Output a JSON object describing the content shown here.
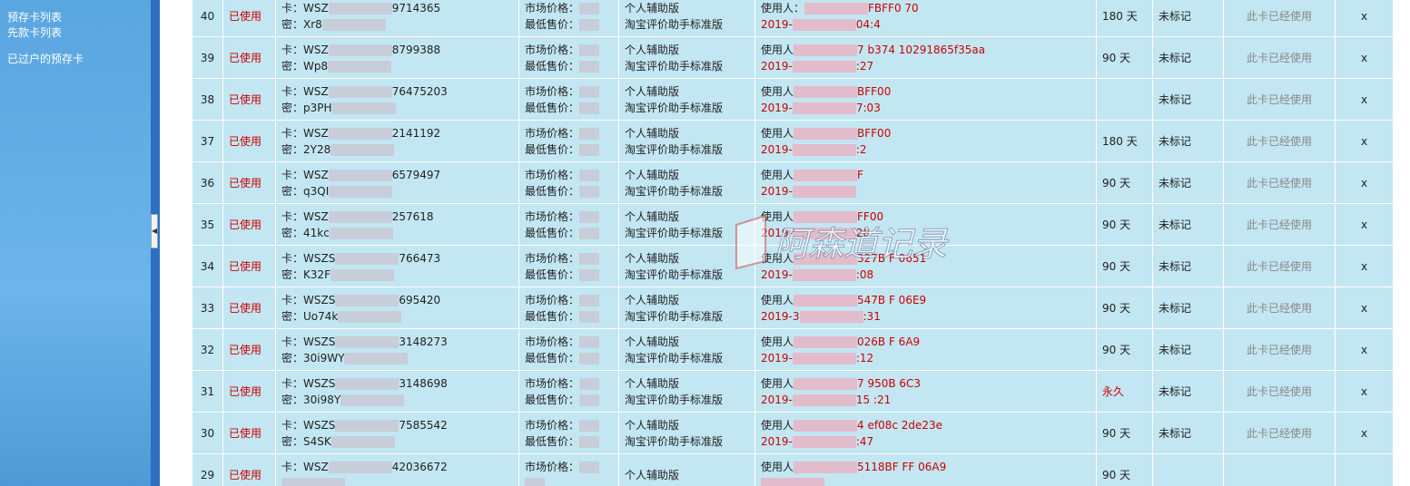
{
  "sidebar": {
    "items": [
      {
        "label": "预存卡列表"
      },
      {
        "label": "先款卡列表"
      },
      {
        "label": "已过户的预存卡"
      }
    ]
  },
  "table": {
    "rows": [
      {
        "id": "40",
        "status": "已使用",
        "card": "卡：WSZ",
        "card_end": "9714365",
        "pwd": "密：Xr8",
        "price_market": "市场价格：",
        "price_min": "最低售价：",
        "product": "个人辅助版",
        "product_full": "淘宝评价助手标准版",
        "user": "使用人：",
        "user_end": "FBFF0   70",
        "date": "2019-",
        "date_end": "04:4",
        "duration": "180 天",
        "mark": "未标记",
        "used": "此卡已经使用",
        "delete": "x"
      },
      {
        "id": "39",
        "status": "已使用",
        "card": "卡：WSZ",
        "card_end": "8799388",
        "pwd": "密：Wp8",
        "price_market": "市场价格：",
        "price_min": "最低售价：",
        "product": "个人辅助版",
        "product_full": "淘宝评价助手标准版",
        "user": "使用人",
        "user_end": "7   b374        10291865f35aa",
        "date": "2019-",
        "date_end": ":27",
        "duration": "90 天",
        "mark": "未标记",
        "used": "此卡已经使用",
        "delete": "x"
      },
      {
        "id": "38",
        "status": "已使用",
        "card": "卡：WSZ",
        "card_end": "76475203",
        "pwd": "密：p3PH",
        "price_market": "市场价格：",
        "price_min": "最低售价：",
        "product": "个人辅助版",
        "product_full": "淘宝评价助手标准版",
        "user": "使用人",
        "user_end": "BFF00",
        "date": "2019-",
        "date_end": "7:03",
        "duration": "",
        "mark": "未标记",
        "used": "此卡已经使用",
        "delete": "x"
      },
      {
        "id": "37",
        "status": "已使用",
        "card": "卡：WSZ",
        "card_end": "2141192",
        "pwd": "密：2Y28",
        "price_market": "市场价格：",
        "price_min": "最低售价：",
        "product": "个人辅助版",
        "product_full": "淘宝评价助手标准版",
        "user": "使用人",
        "user_end": "BFF00",
        "date": "2019-",
        "date_end": ":2",
        "duration": "180 天",
        "mark": "未标记",
        "used": "此卡已经使用",
        "delete": "x"
      },
      {
        "id": "36",
        "status": "已使用",
        "card": "卡：WSZ",
        "card_end": "6579497",
        "pwd": "密：q3QI",
        "price_market": "市场价格：",
        "price_min": "最低售价：",
        "product": "个人辅助版",
        "product_full": "淘宝评价助手标准版",
        "user": "使用人",
        "user_end": "F",
        "date": "2019-",
        "date_end": "",
        "duration": "90 天",
        "mark": "未标记",
        "used": "此卡已经使用",
        "delete": "x"
      },
      {
        "id": "35",
        "status": "已使用",
        "card": "卡：WSZ",
        "card_end": "257618",
        "pwd": "密：41kc",
        "price_market": "市场价格：",
        "price_min": "最低售价：",
        "product": "个人辅助版",
        "product_full": "淘宝评价助手标准版",
        "user": "使用人",
        "user_end": "FF00",
        "date": "2019-",
        "date_end": "28",
        "duration": "90 天",
        "mark": "未标记",
        "used": "此卡已经使用",
        "delete": "x"
      },
      {
        "id": "34",
        "status": "已使用",
        "card": "卡：WSZS",
        "card_end": "766473",
        "pwd": "密：K32F",
        "price_market": "市场价格：",
        "price_min": "最低售价：",
        "product": "个人辅助版",
        "product_full": "淘宝评价助手标准版",
        "user": "使用人",
        "user_end": "327B    F    0651",
        "date": "2019-",
        "date_end": ":08",
        "duration": "90 天",
        "mark": "未标记",
        "used": "此卡已经使用",
        "delete": "x"
      },
      {
        "id": "33",
        "status": "已使用",
        "card": "卡：WSZS",
        "card_end": "695420",
        "pwd": "密：Uo74k",
        "price_market": "市场价格：",
        "price_min": "最低售价：",
        "product": "个人辅助版",
        "product_full": "淘宝评价助手标准版",
        "user": "使用人",
        "user_end": "547B    F    06E9",
        "date": "2019-3",
        "date_end": ":31",
        "duration": "90 天",
        "mark": "未标记",
        "used": "此卡已经使用",
        "delete": "x"
      },
      {
        "id": "32",
        "status": "已使用",
        "card": "卡：WSZS",
        "card_end": "3148273",
        "pwd": "密：30i9WY",
        "price_market": "市场价格：",
        "price_min": "最低售价：",
        "product": "个人辅助版",
        "product_full": "淘宝评价助手标准版",
        "user": "使用人",
        "user_end": "026B    F    6A9",
        "date": "2019-",
        "date_end": ":12",
        "duration": "90 天",
        "mark": "未标记",
        "used": "此卡已经使用",
        "delete": "x"
      },
      {
        "id": "31",
        "status": "已使用",
        "card": "卡：WSZS",
        "card_end": "3148698",
        "pwd": "密：30i98Y",
        "price_market": "市场价格：",
        "price_min": "最低售价：",
        "product": "个人辅助版",
        "product_full": "淘宝评价助手标准版",
        "user": "使用人",
        "user_end": "7   950B        6C3",
        "date": "2019-",
        "date_end": "15   :21",
        "duration": "永久",
        "mark": "未标记",
        "used": "此卡已经使用",
        "delete": "x"
      },
      {
        "id": "30",
        "status": "已使用",
        "card": "卡：WSZS",
        "card_end": "7585542",
        "pwd": "密：S4SK",
        "price_market": "市场价格：",
        "price_min": "最低售价：",
        "product": "个人辅助版",
        "product_full": "淘宝评价助手标准版",
        "user": "使用人",
        "user_end": "4   ef08c          2de23e",
        "date": "2019-",
        "date_end": ":47",
        "duration": "90 天",
        "mark": "未标记",
        "used": "此卡已经使用",
        "delete": "x"
      },
      {
        "id": "29",
        "status": "已使用",
        "card": "卡：WSZ",
        "card_end": "42036672",
        "pwd": "",
        "price_market": "市场价格：",
        "price_min": "",
        "product": "个人辅助版",
        "product_full": "",
        "user": "使用人",
        "user_end": "5118BF    FF    06A9",
        "date": "",
        "date_end": "",
        "duration": "90 天",
        "mark": "",
        "used": "",
        "delete": ""
      }
    ]
  },
  "watermark": {
    "text": "阿森道记录"
  },
  "colors": {
    "sidebar": "#5aa6e0",
    "table_bg": "#c2e6f2",
    "status_red": "#cc0000"
  }
}
